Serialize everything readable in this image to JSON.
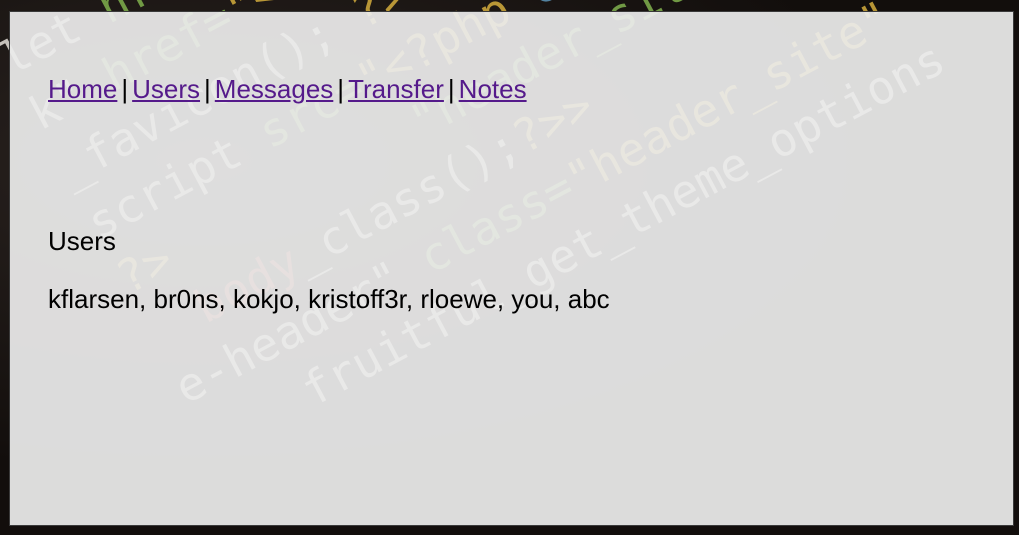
{
  "nav": {
    "links": [
      "Home",
      "Users",
      "Messages",
      "Transfer",
      "Notes"
    ],
    "separator": "|"
  },
  "main": {
    "title": "Users",
    "users_text": "kflarsen, br0ns, kokjo, kristoff3r, rloewe, you, abc"
  },
  "colors": {
    "link": "#551a8b",
    "panel_bg": "#ececec",
    "page_bg": "#120e0c"
  }
}
